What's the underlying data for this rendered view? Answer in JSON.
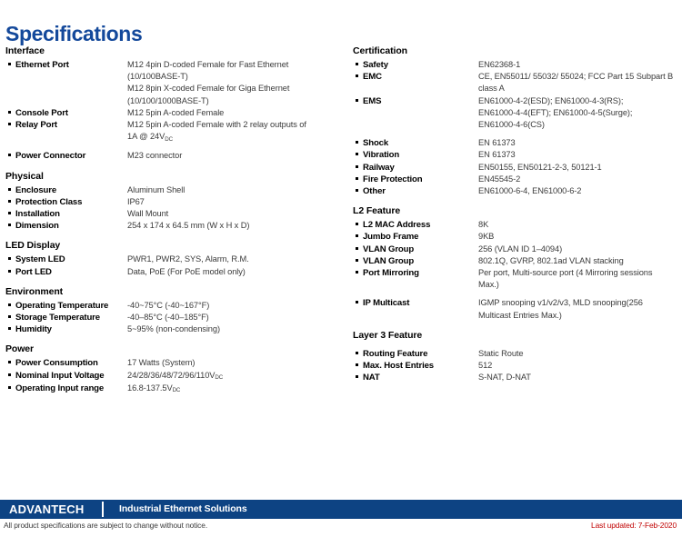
{
  "document": {
    "title": "Specifications"
  },
  "left_column": [
    {
      "heading": "Interface",
      "rows": [
        {
          "label": "Ethernet Port",
          "value": "M12 4pin D-coded Female for Fast Ethernet\n(10/100BASE-T)\nM12 8pin X-coded Female for Giga Ethernet\n(10/100/1000BASE-T)"
        },
        {
          "label": "Console Port",
          "value": "M12 5pin A-coded Female"
        },
        {
          "label": "Relay Port",
          "value": "M12 5pin A-coded Female with 2 relay outputs of\n1A @ 24V",
          "sub": "DC"
        },
        {
          "label": "Power Connector",
          "value": "M23 connector",
          "gap": true
        }
      ]
    },
    {
      "heading": "Physical",
      "rows": [
        {
          "label": "Enclosure",
          "value": "Aluminum Shell"
        },
        {
          "label": "Protection Class",
          "value": "IP67"
        },
        {
          "label": "Installation",
          "value": "Wall Mount"
        },
        {
          "label": "Dimension",
          "value": "254 x 174 x 64.5 mm (W x H x D)"
        }
      ]
    },
    {
      "heading": "LED Display",
      "rows": [
        {
          "label": "System LED",
          "value": "PWR1, PWR2, SYS, Alarm, R.M."
        },
        {
          "label": "Port LED",
          "value": "Data, PoE (For PoE model only)"
        }
      ]
    },
    {
      "heading": "Environment",
      "rows": [
        {
          "label": "Operating Temperature",
          "value": "-40~75°C (-40~167°F)"
        },
        {
          "label": "Storage Temperature",
          "value": "-40–85°C (-40–185°F)"
        },
        {
          "label": "Humidity",
          "value": "5~95% (non-condensing)"
        }
      ]
    },
    {
      "heading": "Power",
      "rows": [
        {
          "label": "Power Consumption",
          "value": "17 Watts (System)"
        },
        {
          "label": "Nominal Input Voltage",
          "value": "24/28/36/48/72/96/110V",
          "sub": "DC"
        },
        {
          "label": "Operating Input range",
          "value": "16.8-137.5V",
          "sub": "DC"
        }
      ]
    }
  ],
  "right_column": [
    {
      "heading": "Certification",
      "rows": [
        {
          "label": "Safety",
          "value": "EN62368-1"
        },
        {
          "label": "EMC",
          "value": "CE, EN55011/ 55032/ 55024; FCC Part 15 Subpart B\nclass A"
        },
        {
          "label": "EMS",
          "value": "EN61000-4-2(ESD); EN61000-4-3(RS);\nEN61000-4-4(EFT); EN61000-4-5(Surge);\nEN61000-4-6(CS)"
        },
        {
          "label": "Shock",
          "value": "EN 61373",
          "gap": true
        },
        {
          "label": "Vibration",
          "value": "EN 61373"
        },
        {
          "label": "Railway",
          "value": "EN50155, EN50121-2-3, 50121-1"
        },
        {
          "label": "Fire Protection",
          "value": "EN45545-2"
        },
        {
          "label": "Other",
          "value": "EN61000-6-4, EN61000-6-2"
        }
      ]
    },
    {
      "heading": "L2 Feature",
      "rows": [
        {
          "label": "L2 MAC Address",
          "value": "8K"
        },
        {
          "label": "Jumbo Frame",
          "value": "9KB"
        },
        {
          "label": "VLAN Group",
          "value": "256 (VLAN ID 1–4094)"
        },
        {
          "label": "VLAN Group",
          "value": "802.1Q, GVRP, 802.1ad VLAN stacking"
        },
        {
          "label": "Port Mirroring",
          "value": "Per port, Multi-source port (4 Mirroring sessions\nMax.)"
        },
        {
          "label": "IP Multicast",
          "value": "IGMP snooping v1/v2/v3, MLD snooping(256\nMulticast Entries Max.)",
          "gap": true
        }
      ]
    },
    {
      "heading": "Layer 3 Feature",
      "rows": [
        {
          "label": "Routing Feature",
          "value": "Static Route",
          "gap": true
        },
        {
          "label": "Max. Host Entries",
          "value": "512"
        },
        {
          "label": "NAT",
          "value": "S-NAT, D-NAT"
        }
      ]
    }
  ],
  "footer": {
    "logo_text": "ADVANTECH",
    "tagline": "Industrial Ethernet Solutions",
    "disclaimer": "All product specifications are subject to change without notice.",
    "last_updated": "Last updated: 7-Feb-2020"
  },
  "colors": {
    "title_blue": "#14499b",
    "footer_bar": "#0d4383",
    "updated_red": "#c00000"
  }
}
